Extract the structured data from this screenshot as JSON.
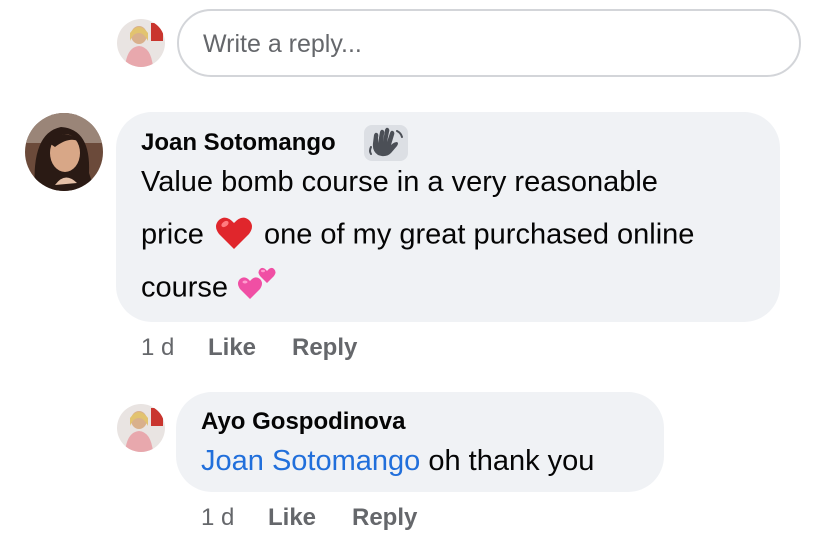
{
  "composer": {
    "placeholder": "Write a reply..."
  },
  "comments": [
    {
      "author": "Joan Sotomango",
      "badge_icon": "waving-hand-icon",
      "line1": "Value bomb course in a very reasonable",
      "line2_before": "price",
      "line2_emoji": "red-heart-icon",
      "line2_after": "one of my great purchased online",
      "line3": "course",
      "line3_emoji": "two-hearts-icon",
      "time": "1 d",
      "like_label": "Like",
      "reply_label": "Reply"
    },
    {
      "author": "Ayo Gospodinova",
      "mention": "Joan Sotomango",
      "text": "oh thank you",
      "time": "1 d",
      "like_label": "Like",
      "reply_label": "Reply"
    }
  ],
  "colors": {
    "bubble": "#f0f2f5",
    "mention": "#216fdb",
    "meta": "#65676b",
    "text": "#050505"
  }
}
